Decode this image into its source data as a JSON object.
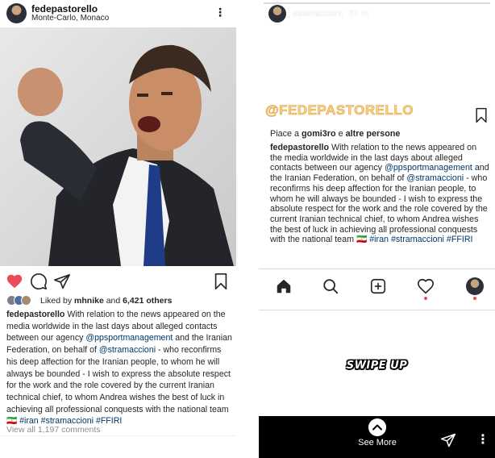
{
  "post": {
    "username": "fedepastorello",
    "location": "Monte-Carlo, Monaco",
    "more_glyph": "⋮",
    "liked_by_prefix": "Liked by ",
    "liked_by_user": "mhnike",
    "liked_by_and": " and ",
    "liked_by_count": "6,421 others",
    "caption_user": "fedepastorello",
    "caption_part1": " With relation to the news appeared on the media worldwide in the last days about alleged contacts between our agency ",
    "caption_mention1": "@ppsportmanagement",
    "caption_part2": " and the Iranian Federation, on behalf of ",
    "caption_mention2": "@stramaccioni",
    "caption_part3": " - who reconfirms his deep affection for the Iranian people, to whom he will always be bounded - I wish to express the absolute respect for the work and the role covered by the current Iranian technical chief, to whom Andrea wishes the best of luck in achieving all professional conquests with the national team ",
    "caption_flag": "🇮🇷",
    "caption_tags": " #iran #stramaccioni #FFIRI",
    "comments_link": "View all 1,197 comments",
    "liked": true
  },
  "story": {
    "username": "stramaccioni",
    "time": "51 m",
    "progress": 0.98,
    "handle": "@FEDEPASTORELLO",
    "piace_prefix": "Piace a ",
    "piace_user": "gomi3ro",
    "piace_and": " e ",
    "piace_others": "altre persone",
    "caption_user": "fedepastorello",
    "caption_part1": " With relation to the news appeared on the media worldwide in the last days about alleged contacts between our agency ",
    "caption_mention1": "@ppsportmanagement",
    "caption_part2": " and the Iranian Federation, on behalf of ",
    "caption_mention2": "@stramaccioni",
    "caption_part3": " - who reconfirms his deep affection for the Iranian people, to whom he will always be bounded - I wish to express the absolute respect for the work and the role covered by the current Iranian technical chief, to whom Andrea wishes the best of luck in achieving all professional conquests with the national team ",
    "caption_flag": "🇮🇷",
    "caption_tags": " #iran #stramaccioni #FFIRI",
    "swipe_up": "SWIPE UP",
    "see_more": "See More",
    "more_glyph": "⋮"
  },
  "colors": {
    "like_red": "#ed4956",
    "link_blue": "#00376b",
    "handle_gold": "#f1d58a",
    "handle_orange": "#e79a3c",
    "story_bg": "#000000"
  },
  "icons": [
    "heart-icon",
    "comment-icon",
    "share-icon",
    "bookmark-icon",
    "home-icon",
    "search-icon",
    "add-post-icon",
    "activity-icon",
    "profile-icon",
    "chevron-up-icon",
    "send-icon",
    "more-icon"
  ]
}
